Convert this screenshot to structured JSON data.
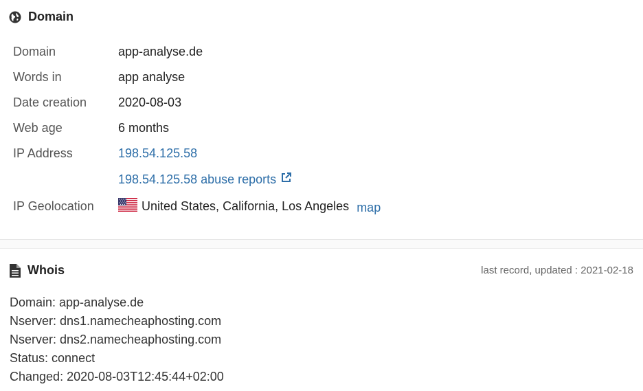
{
  "domain_section": {
    "title": "Domain",
    "icon": "globe-icon",
    "rows": {
      "domain": {
        "label": "Domain",
        "value": "app-analyse.de"
      },
      "words": {
        "label": "Words in",
        "value": "app analyse"
      },
      "creation": {
        "label": "Date creation",
        "value": "2020-08-03"
      },
      "age": {
        "label": "Web age",
        "value": "6 months"
      },
      "ip": {
        "label": "IP Address",
        "value": "198.54.125.58",
        "abuse": "198.54.125.58 abuse reports"
      },
      "geo": {
        "label": "IP Geolocation",
        "value": "United States, California, Los Angeles",
        "map": "map",
        "flag": "us-flag-icon"
      }
    }
  },
  "whois_section": {
    "title": "Whois",
    "icon": "document-icon",
    "updated": "last record, updated : 2021-02-18",
    "lines": [
      "Domain: app-analyse.de",
      "Nserver: dns1.namecheaphosting.com",
      "Nserver: dns2.namecheaphosting.com",
      "Status: connect",
      "Changed: 2020-08-03T12:45:44+02:00"
    ]
  },
  "colors": {
    "link": "#2d6ea8",
    "text": "#222222",
    "label": "#555555"
  }
}
